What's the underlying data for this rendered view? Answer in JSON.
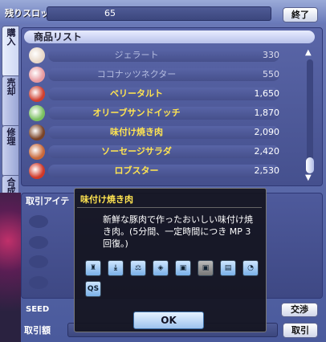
{
  "header": {
    "slot_label": "残りスロット",
    "slot_value": "65",
    "close_label": "終了"
  },
  "tabs": [
    "購入",
    "売却",
    "修理",
    "合成"
  ],
  "list": {
    "title": "商品リスト",
    "items": [
      {
        "name": "ジェラート",
        "price": "330",
        "dim": true,
        "icon": "gelato-icon",
        "color": "#e8d8c8"
      },
      {
        "name": "ココナッツネクター",
        "price": "550",
        "dim": true,
        "icon": "coconut-nectar-icon",
        "color": "#e89aa0"
      },
      {
        "name": "ベリータルト",
        "price": "1,650",
        "dim": false,
        "icon": "berry-tart-icon",
        "color": "#d04030"
      },
      {
        "name": "オリーブサンドイッチ",
        "price": "1,870",
        "dim": false,
        "icon": "olive-sandwich-icon",
        "color": "#7ac060"
      },
      {
        "name": "味付け焼き肉",
        "price": "2,090",
        "dim": false,
        "icon": "grilled-meat-icon",
        "color": "#7a4428"
      },
      {
        "name": "ソーセージサラダ",
        "price": "2,420",
        "dim": false,
        "icon": "sausage-salad-icon",
        "color": "#c8683a"
      },
      {
        "name": "ロブスター",
        "price": "2,530",
        "dim": false,
        "icon": "lobster-icon",
        "color": "#d03828"
      }
    ]
  },
  "trade": {
    "header": "取引アイテ",
    "seed_label": "SEED",
    "amount_label": "取引額",
    "exchange_label": "交渉",
    "trade_label": "取引"
  },
  "tooltip": {
    "title": "味付け焼き肉",
    "description": "新鮮な豚肉で作ったおいしい味付け焼き肉。(5分間、一定時間につき MP 3 回復。)",
    "icons": [
      "item-icon-1",
      "item-icon-2",
      "item-icon-3",
      "item-icon-4",
      "item-icon-5",
      "item-icon-6",
      "item-icon-7",
      "item-icon-8",
      "item-icon-9"
    ],
    "qs_label": "QS",
    "ok_label": "OK"
  }
}
